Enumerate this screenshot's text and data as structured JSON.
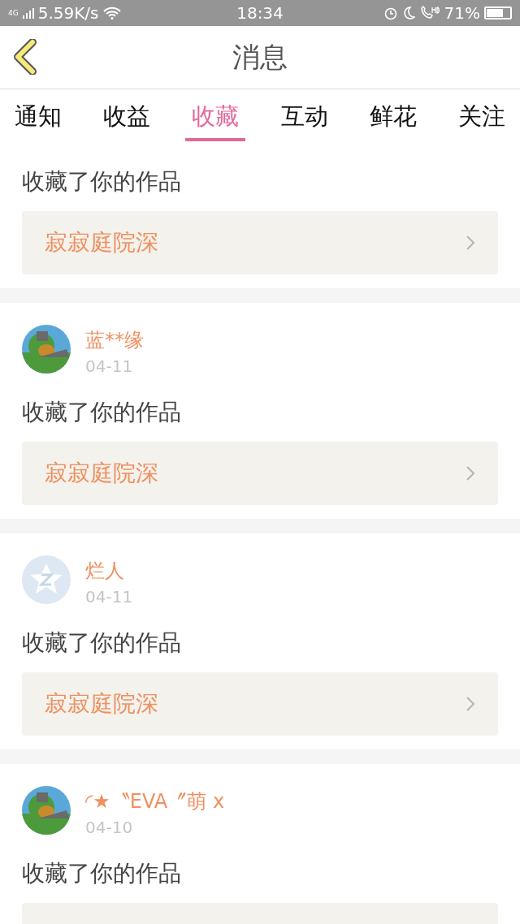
{
  "status_bar": {
    "network": "4G",
    "speed": "5.59K/s",
    "time": "18:34",
    "battery": "71%"
  },
  "header": {
    "title": "消息"
  },
  "tabs": [
    {
      "label": "通知",
      "selected": false
    },
    {
      "label": "收益",
      "selected": false
    },
    {
      "label": "收藏",
      "selected": true
    },
    {
      "label": "互动",
      "selected": false
    },
    {
      "label": "鲜花",
      "selected": false
    },
    {
      "label": "关注",
      "selected": false
    }
  ],
  "messages": [
    {
      "action": "收藏了你的作品",
      "work": "寂寂庭院深"
    },
    {
      "user": {
        "name": "蓝**缘",
        "date": "04-11",
        "kind": "picture"
      },
      "action": "收藏了你的作品",
      "work": "寂寂庭院深"
    },
    {
      "user": {
        "name": "烂人",
        "date": "04-11",
        "kind": "default"
      },
      "action": "收藏了你的作品",
      "work": "寂寂庭院深"
    },
    {
      "user": {
        "name": "◜★〝EVA〞萌 x",
        "date": "04-10",
        "kind": "picture"
      },
      "action": "收藏了你的作品"
    }
  ]
}
